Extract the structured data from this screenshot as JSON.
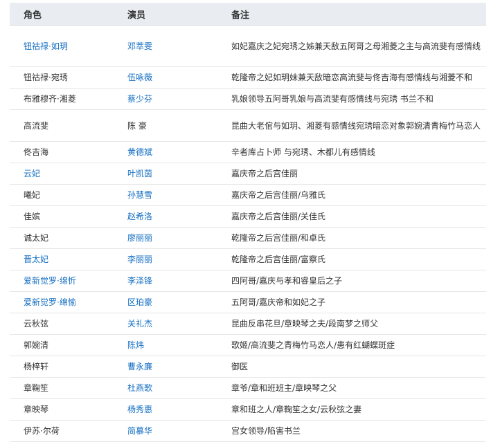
{
  "headers": {
    "role": "角色",
    "actor": "演员",
    "note": "备注"
  },
  "rows": [
    {
      "role": "钮祜禄·如玥",
      "actor": "邓萃雯",
      "note": "如妃嘉庆之妃宛琇之姊兼天敌五阿哥之母湘菱之主与高流斐有感情线",
      "role_link": true,
      "actor_link": true
    },
    {
      "role": "钮祜禄·宛琇",
      "actor": "伍咏薇",
      "note": "乾隆帝之妃如玥妹兼天敌暗恋高流斐与佟吉海有感情线与湘菱不和",
      "role_link": false,
      "actor_link": true
    },
    {
      "role": "布雅穆齐·湘菱",
      "actor": "蔡少芬",
      "note": "乳娘领导五阿哥乳娘与高流斐有感情线与宛琇  书兰不和",
      "role_link": false,
      "actor_link": true
    },
    {
      "role": "高流斐",
      "actor": "陈  豪",
      "note": "昆曲大老倌与如玥、湘菱有感情线宛琇暗恋对象郭婉清青梅竹马恋人",
      "role_link": false,
      "actor_link": false
    },
    {
      "role": "佟吉海",
      "actor": "黄德斌",
      "note": "辛者库占卜师  与宛琇、木都儿有感情线",
      "role_link": false,
      "actor_link": true
    },
    {
      "role": "云妃",
      "actor": "叶凯茵",
      "note": "嘉庆帝之后宫佳丽",
      "role_link": true,
      "actor_link": true
    },
    {
      "role": "曦妃",
      "actor": "孙慧雪",
      "note": "嘉庆帝之后宫佳丽/乌雅氏",
      "role_link": false,
      "actor_link": true
    },
    {
      "role": "佳嫔",
      "actor": "赵希洛",
      "note": "嘉庆帝之后宫佳丽/关佳氏",
      "role_link": false,
      "actor_link": true
    },
    {
      "role": "诚太妃",
      "actor": "廖丽丽",
      "note": "乾隆帝之后宫佳丽/和卓氏",
      "role_link": false,
      "actor_link": true
    },
    {
      "role": "晋太妃",
      "actor": "李丽丽",
      "note": "乾隆帝之后宫佳丽/富察氏",
      "role_link": true,
      "actor_link": true
    },
    {
      "role": "爱新觉罗·绵忻",
      "actor": "李泽锋",
      "note": "四阿哥/嘉庆与孝和睿皇后之子",
      "role_link": true,
      "actor_link": true
    },
    {
      "role": "爱新觉罗·绵愉",
      "actor": "区珀豪",
      "note": "五阿哥/嘉庆帝和如妃之子",
      "role_link": true,
      "actor_link": true
    },
    {
      "role": "云秋弦",
      "actor": "关礼杰",
      "note": "昆曲反串花旦/章映琴之夫/段南梦之师父",
      "role_link": false,
      "actor_link": true
    },
    {
      "role": "郭婉清",
      "actor": "陈炜",
      "note": "歌姬/高流斐之青梅竹马恋人/患有红蝴蝶斑症",
      "role_link": false,
      "actor_link": true
    },
    {
      "role": "杨梓轩",
      "actor": "曹永廉",
      "note": "御医",
      "role_link": false,
      "actor_link": true
    },
    {
      "role": "章鞠笙",
      "actor": "杜燕歌",
      "note": "章爷/章和班班主/章映琴之父",
      "role_link": false,
      "actor_link": true
    },
    {
      "role": "章映琴",
      "actor": "杨秀惠",
      "note": "章和班之人/章鞠笙之女/云秋弦之妻",
      "role_link": false,
      "actor_link": true
    },
    {
      "role": "伊苏·尔荷",
      "actor": "简慕华",
      "note": "宫女领导/陷害书兰",
      "role_link": false,
      "actor_link": true
    }
  ],
  "colors": {
    "header_bg": "#e9edf2",
    "link": "#136ec2",
    "text": "#333333",
    "row_border": "#e6e6e6"
  }
}
